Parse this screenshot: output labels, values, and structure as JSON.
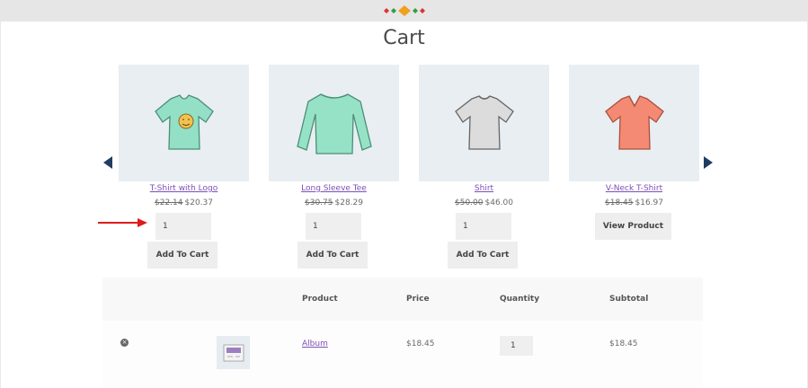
{
  "page_title": "Cart",
  "colors": {
    "link": "#7e4fb8",
    "arrow_nav": "#1f3d63",
    "annotation_arrow": "#e01b1b"
  },
  "products": [
    {
      "name": "T-Shirt with Logo",
      "old_price": "$22.14",
      "price": "$20.37",
      "quantity": "1",
      "button": "Add To Cart",
      "color": "#8fe0c4"
    },
    {
      "name": "Long Sleeve Tee",
      "old_price": "$30.75",
      "price": "$28.29",
      "quantity": "1",
      "button": "Add To Cart",
      "color": "#93e0c4"
    },
    {
      "name": "Shirt",
      "old_price": "$50.00",
      "price": "$46.00",
      "quantity": "1",
      "button": "Add To Cart",
      "color": "#dadada"
    },
    {
      "name": "V-Neck T-Shirt",
      "old_price": "$18.45",
      "price": "$16.97",
      "button": "View Product",
      "color": "#f48973"
    }
  ],
  "cart_table": {
    "headers": {
      "product": "Product",
      "price": "Price",
      "quantity": "Quantity",
      "subtotal": "Subtotal"
    },
    "rows": [
      {
        "product": "Album",
        "price": "$18.45",
        "quantity": "1",
        "subtotal": "$18.45"
      }
    ]
  },
  "icons": {
    "prev": "triangle-left-icon",
    "next": "triangle-right-icon",
    "remove": "remove-circle-icon"
  }
}
